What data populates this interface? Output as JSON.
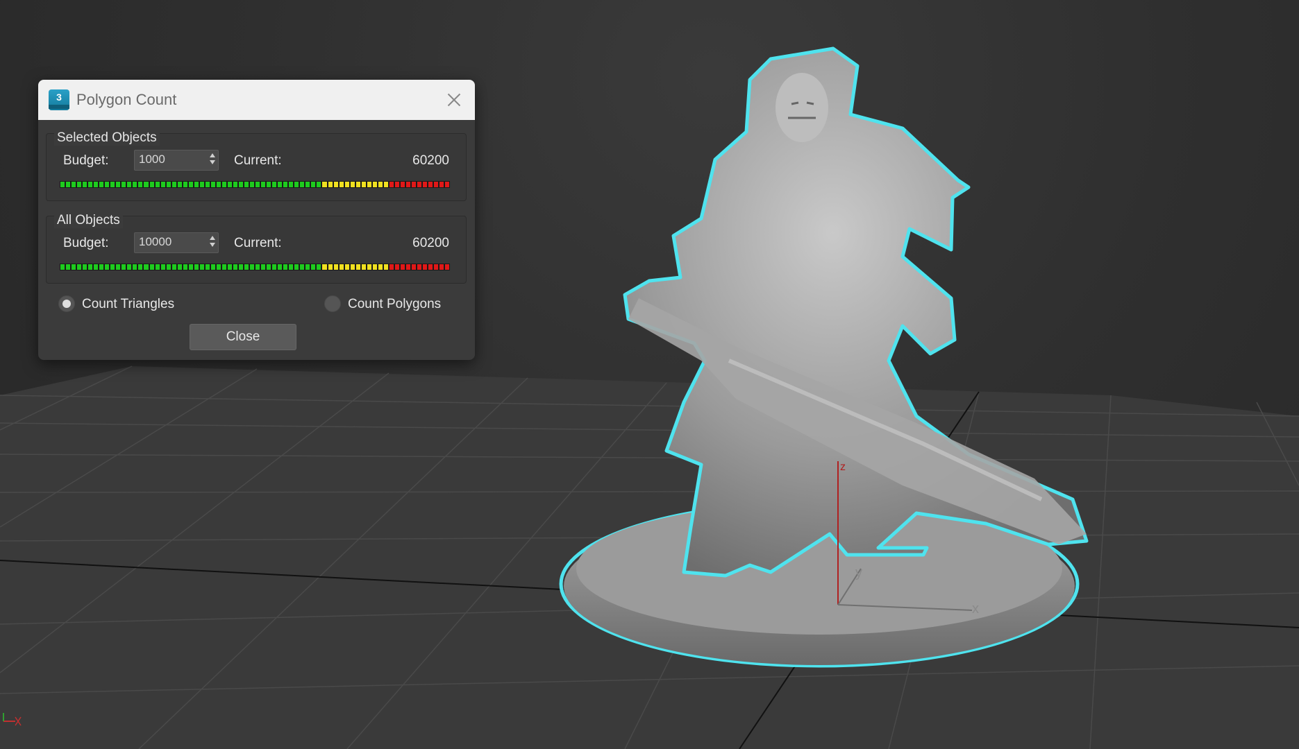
{
  "dialog": {
    "title": "Polygon Count",
    "app_icon_label": "3",
    "selected": {
      "title": "Selected Objects",
      "budget_label": "Budget:",
      "budget_value": "1000",
      "current_label": "Current:",
      "current_value": "60200"
    },
    "all": {
      "title": "All Objects",
      "budget_label": "Budget:",
      "budget_value": "10000",
      "current_label": "Current:",
      "current_value": "60200"
    },
    "count_triangles_label": "Count Triangles",
    "count_polygons_label": "Count Polygons",
    "count_mode": "triangles",
    "close_label": "Close"
  },
  "viewport": {
    "axis_labels": {
      "x": "x",
      "y": "y",
      "z": "z"
    },
    "selection_color": "#4fe3ee",
    "grid_color": "#4b4b4b"
  },
  "colors": {
    "meter_green": "#1ecb1e",
    "meter_yellow": "#f0e020",
    "meter_red": "#e01818"
  }
}
